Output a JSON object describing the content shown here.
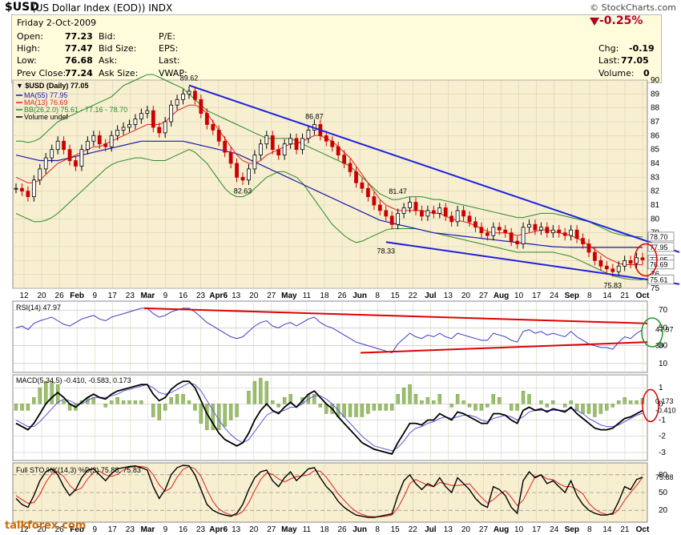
{
  "header": {
    "symbol": "$USD",
    "name": "(US Dollar Index (EOD))",
    "exchange": "INDX",
    "source": "© StockCharts.com"
  },
  "quote": {
    "date": "Friday  2-Oct-2009",
    "open_label": "Open:",
    "open": "77.23",
    "high_label": "High:",
    "high": "77.47",
    "low_label": "Low:",
    "low": "76.68",
    "prev_label": "Prev Close:",
    "prev": "77.24",
    "bid_label": "Bid:",
    "bidsize_label": "Bid Size:",
    "ask_label": "Ask:",
    "asksize_label": "Ask Size:",
    "pe_label": "P/E:",
    "eps_label": "EPS:",
    "last_label": "Last:",
    "vwap_label": "VWAP:",
    "change_pct": "-0.25%",
    "chg_label": "Chg:",
    "chg": "-0.19",
    "last2_label": "Last:",
    "last": "77.05",
    "volume_label": "Volume:",
    "volume": "0"
  },
  "colors": {
    "price_up": "#000000",
    "price_down": "#cc0000",
    "ma55": "#1a1aa8",
    "ma13": "#e02020",
    "bb": "#2a8a2a",
    "trend": "#2020dd",
    "panel_bg": "#f7efd0",
    "panel_bg2": "#ffffff"
  },
  "chart_data": [
    {
      "type": "line",
      "title": "$USD (Daily) 77.05",
      "legend": [
        "MA(55) 77.95",
        "MA(13) 76.69",
        "BB(26,2.0) 75.61 - 77.16 - 78.70",
        "Volume undef"
      ],
      "y_ticks": [
        "90",
        "89",
        "88",
        "87",
        "86",
        "85",
        "84",
        "83",
        "82",
        "81",
        "80",
        "79",
        "78",
        "77",
        "76",
        "75"
      ],
      "x_ticks": [
        "12",
        "20",
        "26",
        "Feb",
        "9",
        "17",
        "23",
        "Mar",
        "9",
        "16",
        "23",
        "Apr6",
        "13",
        "20",
        "27",
        "May",
        "11",
        "18",
        "26",
        "Jun",
        "8",
        "15",
        "22",
        "Jul",
        "13",
        "20",
        "27",
        "Aug",
        "10",
        "17",
        "24",
        "Sep",
        "8",
        "14",
        "21",
        "Oct"
      ],
      "annotations": [
        "89.62",
        "86.87",
        "82.63",
        "81.47",
        "78.33",
        "75.83"
      ],
      "right_labels": [
        "78.70",
        "77.95",
        "77.05",
        "76.69",
        "75.61"
      ],
      "ylim": [
        75,
        90
      ],
      "close_series": [
        82.2,
        82.0,
        81.6,
        82.8,
        83.6,
        84.4,
        85.0,
        85.6,
        85.0,
        84.2,
        83.8,
        85.0,
        85.6,
        86.0,
        85.4,
        85.2,
        86.0,
        86.4,
        86.6,
        86.8,
        87.2,
        87.6,
        87.8,
        86.6,
        86.2,
        87.0,
        88.2,
        88.6,
        89.0,
        89.2,
        88.6,
        87.6,
        86.8,
        86.4,
        85.6,
        84.8,
        84.0,
        83.0,
        82.8,
        83.6,
        84.6,
        85.4,
        86.0,
        85.0,
        84.6,
        85.4,
        85.8,
        85.0,
        85.8,
        86.4,
        86.8,
        86.0,
        85.6,
        85.2,
        84.6,
        84.0,
        83.4,
        82.6,
        82.2,
        81.6,
        81.0,
        80.6,
        80.2,
        79.6,
        80.4,
        80.8,
        81.2,
        80.6,
        80.2,
        80.6,
        80.4,
        80.8,
        80.2,
        79.8,
        80.6,
        80.2,
        79.8,
        79.4,
        79.0,
        78.8,
        79.4,
        79.2,
        79.0,
        78.4,
        78.2,
        79.4,
        79.6,
        79.2,
        79.4,
        79.0,
        79.2,
        79.0,
        78.8,
        79.2,
        78.6,
        78.2,
        77.6,
        77.0,
        76.6,
        76.4,
        76.2,
        76.6,
        77.0,
        76.8,
        77.2,
        77.05
      ],
      "ma13": [
        83.0,
        82.8,
        82.6,
        82.6,
        82.8,
        83.2,
        83.6,
        84.0,
        84.2,
        84.4,
        84.6,
        84.8,
        85.0,
        85.2,
        85.2,
        85.4,
        85.6,
        85.8,
        86.0,
        86.2,
        86.4,
        86.6,
        86.8,
        86.8,
        86.8,
        87.0,
        87.4,
        87.8,
        88.0,
        88.2,
        88.2,
        88.0,
        87.6,
        87.0,
        86.4,
        85.8,
        85.2,
        84.6,
        84.2,
        84.0,
        84.0,
        84.2,
        84.6,
        84.8,
        85.0,
        85.2,
        85.4,
        85.4,
        85.6,
        85.8,
        86.0,
        86.0,
        85.8,
        85.6,
        85.2,
        84.8,
        84.4,
        83.8,
        83.2,
        82.6,
        82.0,
        81.4,
        81.0,
        80.8,
        80.6,
        80.6,
        80.6,
        80.6,
        80.6,
        80.5,
        80.4,
        80.4,
        80.2,
        80.0,
        79.9,
        79.8,
        79.7,
        79.5,
        79.3,
        79.1,
        79.0,
        79.0,
        79.0,
        78.9,
        78.8,
        78.9,
        79.0,
        79.1,
        79.2,
        79.2,
        79.1,
        79.0,
        78.9,
        78.8,
        78.6,
        78.4,
        78.1,
        77.8,
        77.5,
        77.2,
        77.0,
        76.8,
        76.7,
        76.7,
        76.7,
        76.69
      ],
      "ma55": [
        84.6,
        84.5,
        84.4,
        84.3,
        84.2,
        84.2,
        84.2,
        84.2,
        84.3,
        84.4,
        84.5,
        84.6,
        84.7,
        84.8,
        84.9,
        85.0,
        85.1,
        85.2,
        85.3,
        85.4,
        85.5,
        85.6,
        85.6,
        85.6,
        85.6,
        85.6,
        85.6,
        85.6,
        85.6,
        85.5,
        85.4,
        85.3,
        85.2,
        85.1,
        85.0,
        84.9,
        84.8,
        84.7,
        84.5,
        84.3,
        84.1,
        83.9,
        83.7,
        83.5,
        83.3,
        83.1,
        82.9,
        82.7,
        82.5,
        82.3,
        82.1,
        81.9,
        81.7,
        81.5,
        81.3,
        81.1,
        80.9,
        80.7,
        80.5,
        80.3,
        80.1,
        79.9,
        79.8,
        79.7,
        79.6,
        79.5,
        79.4,
        79.3,
        79.2,
        79.1,
        79.0,
        78.95,
        78.9,
        78.85,
        78.8,
        78.75,
        78.7,
        78.65,
        78.6,
        78.55,
        78.5,
        78.45,
        78.4,
        78.35,
        78.3,
        78.25,
        78.2,
        78.15,
        78.1,
        78.05,
        78.0,
        77.98,
        77.96,
        77.95,
        77.95,
        77.95,
        77.95,
        77.95,
        77.95,
        77.95,
        77.95,
        77.95,
        77.95,
        77.95,
        77.95,
        77.95
      ],
      "bb_upper": [
        85.6,
        85.6,
        85.5,
        85.6,
        85.8,
        86.2,
        86.6,
        87.0,
        87.2,
        87.4,
        87.6,
        87.8,
        88.0,
        88.2,
        88.4,
        88.6,
        88.8,
        89.2,
        89.6,
        89.8,
        90.0,
        90.2,
        90.4,
        90.4,
        90.2,
        90.0,
        89.8,
        89.6,
        89.4,
        89.0,
        88.6,
        88.2,
        87.8,
        87.6,
        87.4,
        87.2,
        87.0,
        86.8,
        86.6,
        86.4,
        86.2,
        86.0,
        85.8,
        85.8,
        85.8,
        85.8,
        85.8,
        85.6,
        85.4,
        85.2,
        85.0,
        84.8,
        84.6,
        84.4,
        84.2,
        84.0,
        83.8,
        83.4,
        83.0,
        82.6,
        82.2,
        81.8,
        81.6,
        81.4,
        81.4,
        81.5,
        81.6,
        81.6,
        81.6,
        81.5,
        81.4,
        81.4,
        81.3,
        81.2,
        81.1,
        81.0,
        80.9,
        80.8,
        80.7,
        80.6,
        80.5,
        80.4,
        80.3,
        80.2,
        80.1,
        80.1,
        80.2,
        80.3,
        80.4,
        80.4,
        80.4,
        80.3,
        80.2,
        80.1,
        80.0,
        79.9,
        79.8,
        79.6,
        79.4,
        79.2,
        79.0,
        78.9,
        78.8,
        78.75,
        78.72,
        78.7
      ],
      "bb_lower": [
        80.4,
        80.2,
        80.0,
        79.8,
        79.8,
        79.9,
        80.1,
        80.4,
        80.8,
        81.2,
        81.6,
        82.0,
        82.4,
        82.8,
        83.2,
        83.6,
        83.9,
        84.1,
        84.2,
        84.3,
        84.4,
        84.4,
        84.3,
        84.2,
        84.2,
        84.2,
        84.4,
        84.6,
        84.8,
        85.0,
        84.8,
        84.4,
        84.0,
        83.4,
        82.8,
        82.2,
        81.8,
        81.6,
        81.6,
        81.8,
        82.2,
        82.6,
        83.0,
        83.2,
        83.4,
        83.4,
        83.2,
        83.0,
        82.6,
        82.0,
        81.4,
        80.8,
        80.2,
        79.6,
        79.2,
        78.8,
        78.5,
        78.3,
        78.4,
        78.6,
        78.8,
        79.0,
        79.2,
        79.3,
        79.3,
        79.3,
        79.3,
        79.3,
        79.2,
        79.1,
        79.0,
        78.9,
        78.8,
        78.7,
        78.6,
        78.5,
        78.4,
        78.3,
        78.2,
        78.1,
        78.0,
        77.9,
        77.8,
        77.7,
        77.6,
        77.6,
        77.6,
        77.6,
        77.6,
        77.6,
        77.6,
        77.5,
        77.4,
        77.3,
        77.1,
        76.9,
        76.7,
        76.5,
        76.3,
        76.1,
        75.9,
        75.8,
        75.7,
        75.65,
        75.62,
        75.61
      ]
    },
    {
      "type": "line",
      "title": "RSI(14) 47.97",
      "y_ticks": [
        "70",
        "50",
        "30",
        "10"
      ],
      "right_labels": [
        "47.97",
        "30"
      ],
      "ylim": [
        0,
        80
      ],
      "values": [
        50,
        52,
        48,
        55,
        58,
        60,
        62,
        58,
        54,
        52,
        56,
        60,
        62,
        64,
        60,
        58,
        62,
        64,
        66,
        68,
        70,
        72,
        72,
        66,
        62,
        64,
        68,
        70,
        72,
        72,
        68,
        62,
        56,
        52,
        48,
        44,
        40,
        38,
        40,
        46,
        52,
        56,
        58,
        52,
        50,
        54,
        56,
        52,
        56,
        60,
        62,
        56,
        52,
        50,
        46,
        42,
        38,
        34,
        32,
        30,
        28,
        26,
        24,
        22,
        32,
        38,
        44,
        40,
        38,
        42,
        40,
        44,
        40,
        38,
        44,
        42,
        40,
        38,
        36,
        36,
        44,
        42,
        40,
        36,
        34,
        46,
        48,
        44,
        46,
        42,
        44,
        42,
        40,
        46,
        40,
        36,
        32,
        30,
        28,
        28,
        26,
        34,
        40,
        38,
        44,
        47.97
      ]
    },
    {
      "type": "line",
      "title": "MACD(5,34,5) -0.410, -0.583, 0.173",
      "y_ticks": [
        "1",
        "0",
        "-1",
        "-2",
        "-3"
      ],
      "right_labels": [
        "0.173",
        "-0.410"
      ],
      "ylim": [
        -3.5,
        1.8
      ],
      "series": [
        {
          "name": "MACD",
          "values": [
            -1.2,
            -1.4,
            -1.6,
            -1.2,
            -0.6,
            0.0,
            0.4,
            0.7,
            0.4,
            0.0,
            -0.2,
            0.1,
            0.4,
            0.6,
            0.4,
            0.3,
            0.6,
            0.8,
            0.9,
            1.0,
            1.1,
            1.2,
            1.2,
            0.6,
            0.2,
            0.4,
            0.9,
            1.2,
            1.4,
            1.4,
            1.0,
            0.2,
            -0.6,
            -1.2,
            -1.8,
            -2.2,
            -2.4,
            -2.6,
            -2.4,
            -1.8,
            -1.0,
            -0.4,
            0.0,
            -0.4,
            -0.6,
            -0.2,
            0.1,
            -0.2,
            0.2,
            0.6,
            0.8,
            0.4,
            0.0,
            -0.3,
            -0.8,
            -1.2,
            -1.6,
            -2.0,
            -2.4,
            -2.6,
            -2.8,
            -2.9,
            -3.0,
            -3.1,
            -2.4,
            -1.8,
            -1.2,
            -1.2,
            -1.3,
            -1.0,
            -1.0,
            -0.6,
            -0.8,
            -1.0,
            -0.5,
            -0.6,
            -0.8,
            -1.0,
            -1.2,
            -1.2,
            -0.6,
            -0.6,
            -0.7,
            -1.0,
            -1.2,
            -0.4,
            -0.2,
            -0.4,
            -0.3,
            -0.5,
            -0.3,
            -0.4,
            -0.5,
            -0.2,
            -0.6,
            -0.9,
            -1.2,
            -1.5,
            -1.6,
            -1.6,
            -1.5,
            -1.2,
            -0.9,
            -0.8,
            -0.6,
            -0.41
          ]
        },
        {
          "name": "Signal",
          "values": [
            -1.0,
            -1.2,
            -1.4,
            -1.4,
            -1.1,
            -0.7,
            -0.3,
            0.1,
            0.3,
            0.2,
            0.0,
            0.0,
            0.2,
            0.4,
            0.4,
            0.4,
            0.5,
            0.6,
            0.8,
            0.9,
            1.0,
            1.1,
            1.2,
            1.0,
            0.7,
            0.6,
            0.7,
            0.9,
            1.1,
            1.3,
            1.2,
            0.8,
            0.2,
            -0.4,
            -1.0,
            -1.5,
            -1.9,
            -2.2,
            -2.4,
            -2.2,
            -1.7,
            -1.2,
            -0.7,
            -0.5,
            -0.5,
            -0.4,
            -0.2,
            -0.2,
            0.0,
            0.3,
            0.5,
            0.5,
            0.3,
            0.0,
            -0.4,
            -0.8,
            -1.2,
            -1.6,
            -2.0,
            -2.3,
            -2.6,
            -2.7,
            -2.8,
            -2.9,
            -2.7,
            -2.3,
            -1.8,
            -1.5,
            -1.4,
            -1.2,
            -1.1,
            -0.9,
            -0.8,
            -0.9,
            -0.8,
            -0.7,
            -0.7,
            -0.8,
            -1.0,
            -1.1,
            -0.9,
            -0.8,
            -0.7,
            -0.8,
            -1.0,
            -0.8,
            -0.5,
            -0.4,
            -0.4,
            -0.4,
            -0.4,
            -0.4,
            -0.4,
            -0.3,
            -0.4,
            -0.6,
            -0.9,
            -1.1,
            -1.3,
            -1.4,
            -1.4,
            -1.3,
            -1.1,
            -0.9,
            -0.7,
            -0.583
          ]
        }
      ]
    },
    {
      "type": "line",
      "title": "Full STO %K(14,3) %D(3) 75.88, 75.83",
      "y_ticks": [
        "80",
        "50",
        "20"
      ],
      "right_labels": [
        "75.88"
      ],
      "ylim": [
        0,
        100
      ],
      "series": [
        {
          "name": "%K",
          "values": [
            40,
            30,
            25,
            45,
            70,
            85,
            90,
            80,
            60,
            45,
            55,
            75,
            88,
            90,
            80,
            70,
            82,
            90,
            92,
            94,
            95,
            92,
            88,
            60,
            40,
            55,
            80,
            92,
            96,
            95,
            80,
            55,
            30,
            20,
            15,
            12,
            10,
            15,
            30,
            55,
            75,
            85,
            88,
            70,
            60,
            75,
            85,
            70,
            80,
            90,
            92,
            75,
            60,
            50,
            35,
            25,
            18,
            12,
            10,
            8,
            8,
            10,
            12,
            14,
            45,
            70,
            80,
            65,
            55,
            65,
            60,
            75,
            60,
            50,
            75,
            65,
            55,
            40,
            30,
            25,
            60,
            55,
            45,
            25,
            15,
            70,
            85,
            75,
            80,
            65,
            70,
            60,
            50,
            70,
            45,
            30,
            20,
            15,
            12,
            12,
            15,
            35,
            60,
            55,
            72,
            75.88
          ]
        },
        {
          "name": "%D",
          "values": [
            45,
            38,
            32,
            33,
            47,
            67,
            82,
            85,
            77,
            62,
            53,
            58,
            73,
            84,
            86,
            80,
            77,
            81,
            88,
            92,
            94,
            94,
            92,
            80,
            63,
            52,
            58,
            76,
            89,
            94,
            90,
            77,
            55,
            35,
            22,
            16,
            12,
            12,
            18,
            33,
            53,
            72,
            83,
            81,
            73,
            68,
            73,
            77,
            78,
            80,
            87,
            86,
            76,
            62,
            48,
            37,
            26,
            18,
            13,
            10,
            9,
            9,
            10,
            12,
            24,
            43,
            65,
            72,
            67,
            62,
            60,
            67,
            65,
            62,
            62,
            63,
            65,
            53,
            42,
            32,
            38,
            47,
            53,
            42,
            28,
            37,
            57,
            77,
            80,
            73,
            72,
            65,
            60,
            60,
            55,
            48,
            32,
            22,
            16,
            13,
            13,
            21,
            37,
            50,
            62,
            75.83
          ]
        }
      ]
    }
  ]
}
